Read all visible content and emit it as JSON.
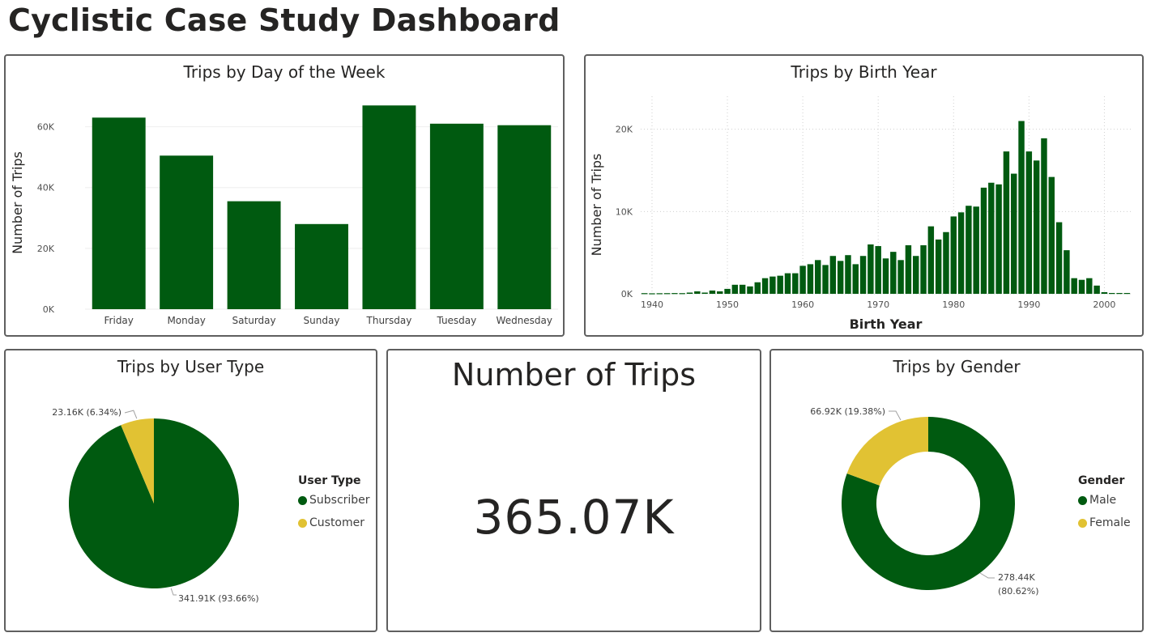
{
  "page": {
    "title": "Cyclistic Case Study Dashboard"
  },
  "colors": {
    "primary": "#005a10",
    "secondary": "#e1c233",
    "card_border": "#5f5f5f",
    "grid": "#e6e6e6"
  },
  "cards": {
    "day_of_week": {
      "title": "Trips by Day of the Week"
    },
    "birth_year": {
      "title": "Trips by Birth Year"
    },
    "user_type": {
      "title": "Trips by User Type"
    },
    "kpi": {
      "title": "Number of Trips",
      "value": "365.07K"
    },
    "gender": {
      "title": "Trips by Gender"
    }
  },
  "chart_data": [
    {
      "type": "bar",
      "title": "Trips by Day of the Week",
      "xlabel": "",
      "ylabel": "Number of Trips",
      "categories": [
        "Friday",
        "Monday",
        "Saturday",
        "Sunday",
        "Thursday",
        "Tuesday",
        "Wednesday"
      ],
      "values": [
        63000,
        50500,
        35500,
        28000,
        67000,
        61000,
        60500
      ],
      "ylim": [
        0,
        70000
      ],
      "yticks": [
        0,
        20000,
        40000,
        60000
      ],
      "ytick_labels": [
        "0K",
        "20K",
        "40K",
        "60K"
      ],
      "grid": true
    },
    {
      "type": "bar",
      "title": "Trips by Birth Year",
      "xlabel": "Birth Year",
      "ylabel": "Number of Trips",
      "x": [
        1939,
        1940,
        1941,
        1942,
        1943,
        1944,
        1945,
        1946,
        1947,
        1948,
        1949,
        1950,
        1951,
        1952,
        1953,
        1954,
        1955,
        1956,
        1957,
        1958,
        1959,
        1960,
        1961,
        1962,
        1963,
        1964,
        1965,
        1966,
        1967,
        1968,
        1969,
        1970,
        1971,
        1972,
        1973,
        1974,
        1975,
        1976,
        1977,
        1978,
        1979,
        1980,
        1981,
        1982,
        1983,
        1984,
        1985,
        1986,
        1987,
        1988,
        1989,
        1990,
        1991,
        1992,
        1993,
        1994,
        1995,
        1996,
        1997,
        1998,
        1999,
        2000,
        2001,
        2002,
        2003
      ],
      "values": [
        80,
        60,
        70,
        80,
        90,
        80,
        150,
        300,
        150,
        400,
        300,
        600,
        1100,
        1100,
        900,
        1400,
        1900,
        2100,
        2200,
        2500,
        2500,
        3400,
        3600,
        4100,
        3500,
        4600,
        4000,
        4700,
        3600,
        4600,
        6000,
        5800,
        4300,
        5100,
        4100,
        5900,
        4600,
        5900,
        8200,
        6600,
        7500,
        9400,
        9900,
        10700,
        10600,
        12900,
        13500,
        13300,
        17300,
        14600,
        21000,
        17300,
        16200,
        18900,
        14200,
        8700,
        5300,
        1900,
        1700,
        1900,
        1000,
        200,
        100,
        100,
        100
      ],
      "xlim": [
        1938.5,
        2003.5
      ],
      "xticks": [
        1940,
        1950,
        1960,
        1970,
        1980,
        1990,
        2000
      ],
      "ylim": [
        0,
        24000
      ],
      "yticks": [
        0,
        10000,
        20000
      ],
      "ytick_labels": [
        "0K",
        "10K",
        "20K"
      ],
      "grid": true
    },
    {
      "type": "pie",
      "title": "Trips by User Type",
      "legend_title": "User Type",
      "legend_position": "right",
      "slices": [
        {
          "label": "Subscriber",
          "value": 341910,
          "percent": 93.66,
          "data_label": "341.91K (93.66%)",
          "color": "#005a10"
        },
        {
          "label": "Customer",
          "value": 23160,
          "percent": 6.34,
          "data_label": "23.16K (6.34%)",
          "color": "#e1c233"
        }
      ]
    },
    {
      "type": "pie",
      "title": "Trips by Gender",
      "donut": true,
      "legend_title": "Gender",
      "legend_position": "right",
      "slices": [
        {
          "label": "Male",
          "value": 278440,
          "percent": 80.62,
          "data_label_line1": "278.44K",
          "data_label_line2": "(80.62%)",
          "color": "#005a10"
        },
        {
          "label": "Female",
          "value": 66920,
          "percent": 19.38,
          "data_label": "66.92K (19.38%)",
          "color": "#e1c233"
        }
      ]
    }
  ]
}
